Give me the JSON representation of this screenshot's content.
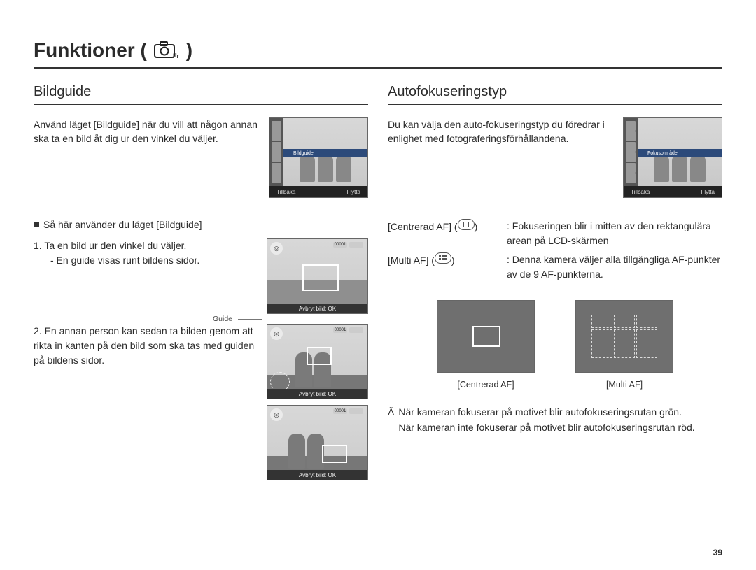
{
  "page": {
    "title": "Funktioner (",
    "title_close": ")",
    "number": "39"
  },
  "left": {
    "heading": "Bildguide",
    "intro": "Använd läget [Bildguide] när du vill att någon annan ska ta en bild åt dig ur den vinkel du väljer.",
    "lcd": {
      "mid_label": "Bildguide",
      "footer_left": "Tillbaka",
      "footer_right": "Flytta"
    },
    "sub_head": "Så här använder du läget [Bildguide]",
    "step1": {
      "line1": "1. Ta en bild ur den vinkel du väljer.",
      "line2": "- En guide visas runt bildens sidor."
    },
    "step2": "2. En annan person kan sedan ta bilden genom att rikta in kanten på den bild som ska tas med guiden på bildens sidor.",
    "guide_label": "Guide",
    "cam": {
      "bar": "Avbryt bild: OK",
      "counter": "00001"
    }
  },
  "right": {
    "heading": "Autofokuseringstyp",
    "intro": "Du kan välja den auto-fokuseringstyp du föredrar i enlighet med fotograferingsförhållandena.",
    "lcd": {
      "mid_label": "Fokusområde",
      "footer_left": "Tillbaka",
      "footer_right": "Flytta"
    },
    "af": {
      "center": {
        "label": "[Centrerad AF] (",
        "label_close": ")",
        "desc": ": Fokuseringen blir i mitten av den rektangulära arean på LCD-skärmen"
      },
      "multi": {
        "label": "[Multi AF] (",
        "label_close": ")",
        "desc": ": Denna kamera väljer alla tillgängliga AF-punkter av de 9 AF-punkterna."
      }
    },
    "ex": {
      "center": "[Centrerad AF]",
      "multi": "[Multi AF]"
    },
    "note": {
      "mark": "Ä",
      "l1": "När kameran fokuserar på motivet blir autofokuseringsrutan grön.",
      "l2": "När kameran inte fokuserar på motivet blir autofokuseringsrutan röd."
    }
  }
}
